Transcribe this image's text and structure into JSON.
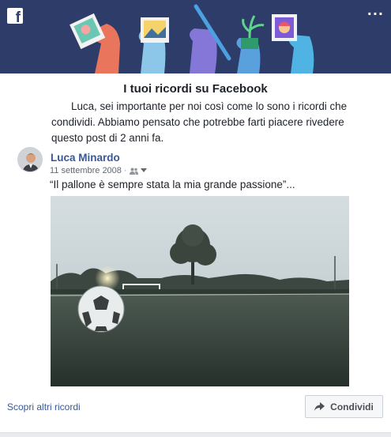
{
  "header": {
    "brand_icon": "facebook-logo",
    "menu_icon": "more-dots-icon"
  },
  "memories": {
    "title": "I tuoi ricordi su Facebook",
    "greeting_name": "Luca",
    "description_first": ", sei importante per noi così come lo sono i ricordi che condividi. Abbiamo pensato che potrebbe farti piacere rivedere questo post di 2 anni fa."
  },
  "post": {
    "author": "Luca Minardo",
    "date": "11 settembre 2008",
    "separator": "·",
    "audience_icon": "friends-icon",
    "text": "“Il pallone è sempre stata la mia grande passione”..."
  },
  "footer": {
    "more_link": "Scopri altri ricordi",
    "share_label": "Condividi",
    "share_icon": "share-arrow-icon"
  },
  "colors": {
    "banner": "#2d3c68",
    "link": "#385898"
  }
}
